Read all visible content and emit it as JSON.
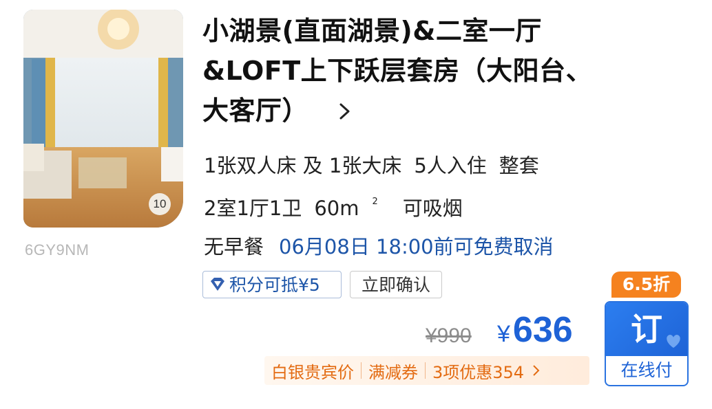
{
  "listing": {
    "photo_count": "10",
    "room_code": "6GY9NM",
    "title_lines": [
      "小湖景(直面湖景)&二室一厅",
      "&LOFT上下跃层套房（大阳台、",
      "大客厅）"
    ],
    "beds": [
      "1张双人床 及 1张大床",
      "5人入住",
      "整套"
    ],
    "layout": "2室1厅1卫",
    "area": "60m",
    "area_sup": "2",
    "smoking": "可吸烟",
    "breakfast": "无早餐",
    "cancellation": "06月08日 18:00前可免费取消",
    "tags": {
      "points": "积分可抵¥5",
      "confirm": "立即确认"
    }
  },
  "pricing": {
    "original_price": "¥990",
    "currency": "¥",
    "price": "636",
    "discount_badge": "6.5折",
    "promos": [
      "白银贵宾价",
      "满减券",
      "3项优惠354"
    ]
  },
  "book_button": {
    "main": "订",
    "sub": "在线付"
  },
  "colors": {
    "accent": "#1e62d6",
    "promo": "#e36b12",
    "discount": "#f5821f"
  },
  "icons": [
    "chevron-right-icon",
    "diamond-icon",
    "heart-icon"
  ]
}
